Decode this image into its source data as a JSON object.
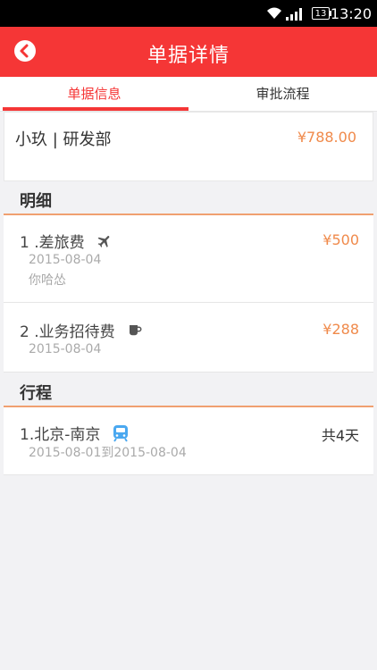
{
  "status": {
    "time": "13:20",
    "battery": "13"
  },
  "header": {
    "title": "单据详情"
  },
  "tabs": [
    {
      "label": "单据信息",
      "active": true
    },
    {
      "label": "审批流程",
      "active": false
    }
  ],
  "summary": {
    "name": "小玖 | 研发部",
    "amount": "¥788.00"
  },
  "sections": {
    "details_title": "明细",
    "trip_title": "行程"
  },
  "details": [
    {
      "title": "1 .差旅费",
      "icon": "airplane-icon",
      "date": "2015-08-04",
      "note": "你哈怂",
      "amount": "¥500"
    },
    {
      "title": "2 .业务招待费",
      "icon": "cup-icon",
      "date": "2015-08-04",
      "amount": "¥288"
    }
  ],
  "trips": [
    {
      "title": "1.北京-南京",
      "icon": "train-icon",
      "dates": "2015-08-01到2015-08-04",
      "days": "共4天"
    }
  ],
  "colors": {
    "primary": "#f53636",
    "amount": "#f08a4b",
    "train": "#4aa8f0"
  }
}
